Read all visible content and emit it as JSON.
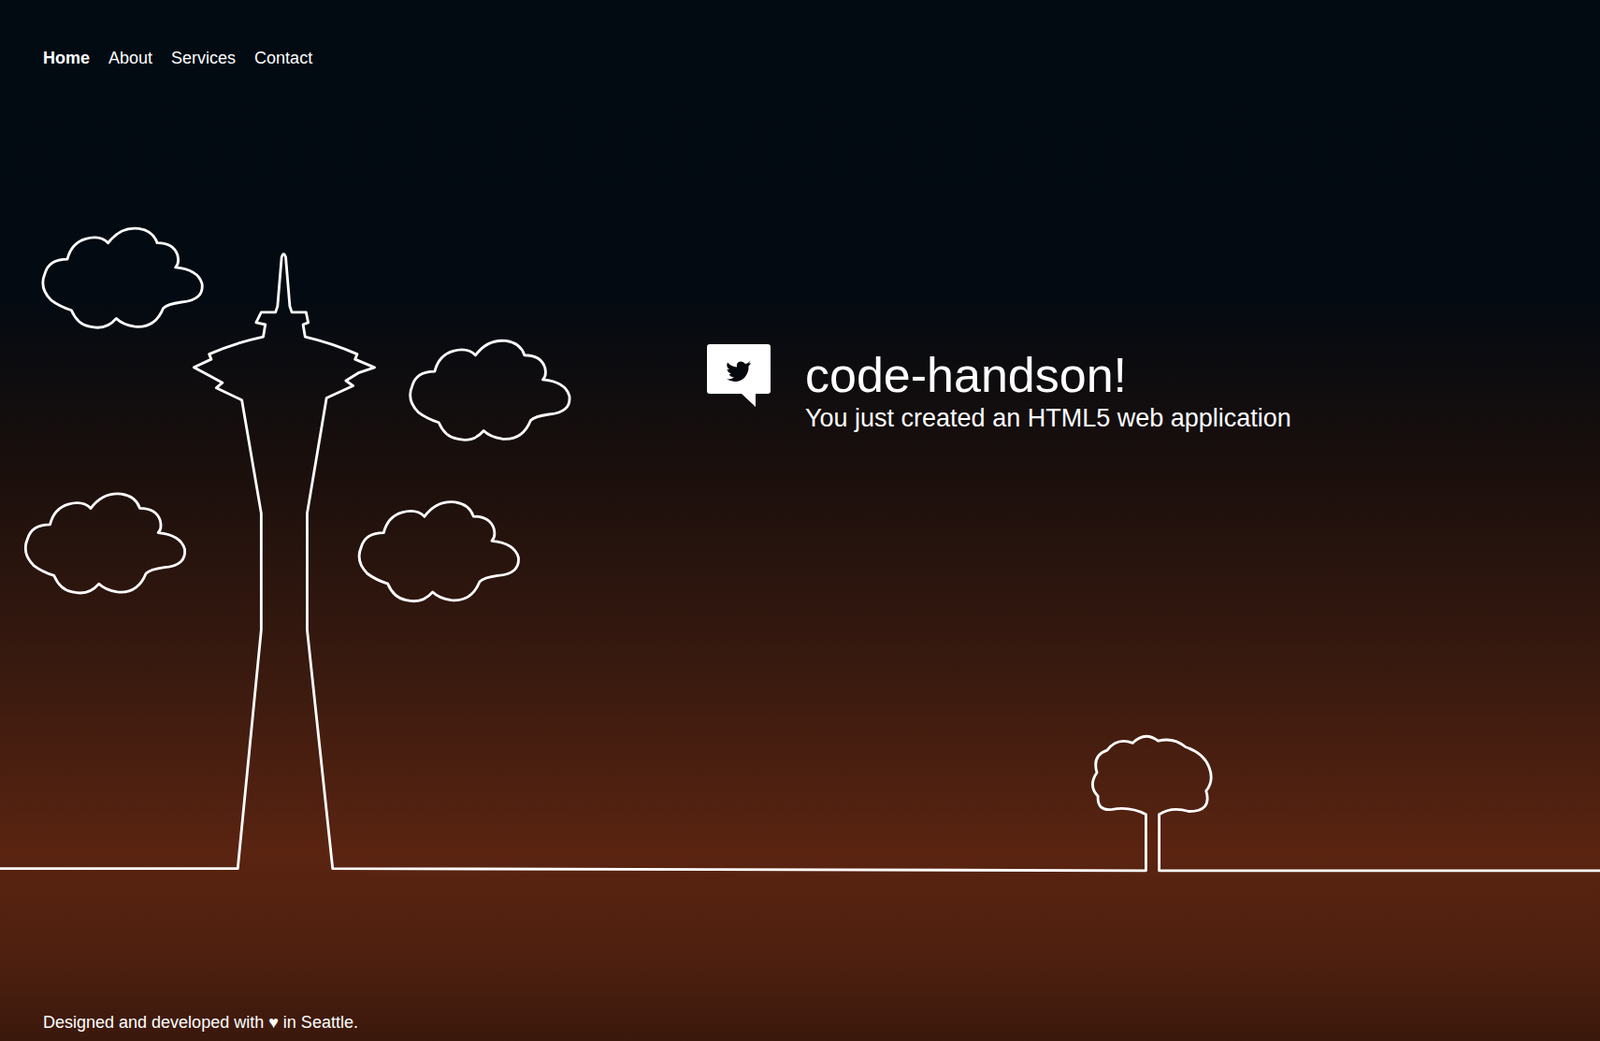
{
  "nav": {
    "items": [
      {
        "label": "Home",
        "selected": true
      },
      {
        "label": "About",
        "selected": false
      },
      {
        "label": "Services",
        "selected": false
      },
      {
        "label": "Contact",
        "selected": false
      }
    ]
  },
  "hero": {
    "title": "code-handson!",
    "subtitle": "You just created an HTML5 web application"
  },
  "footer": {
    "text": "Designed and developed with ♥ in Seattle."
  }
}
